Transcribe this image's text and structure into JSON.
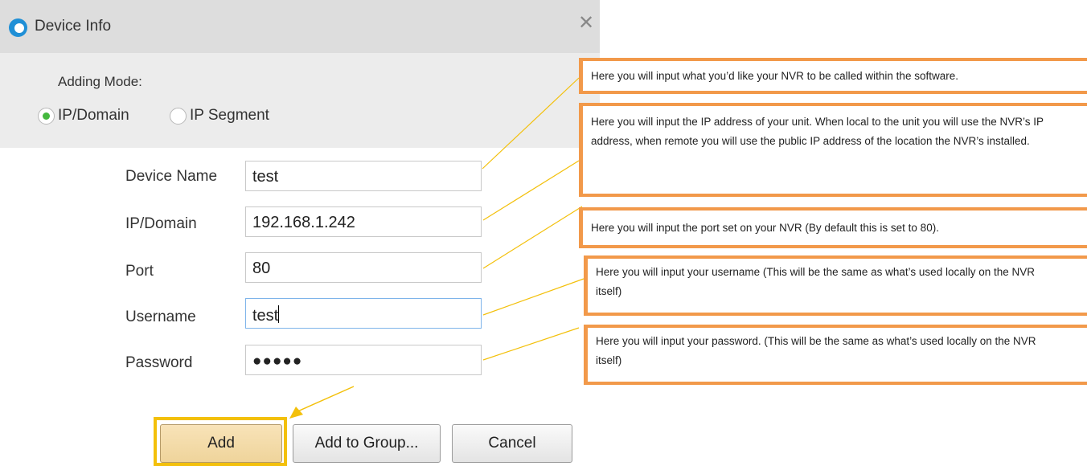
{
  "dialog": {
    "title": "Device Info",
    "adding_mode_label": "Adding Mode:",
    "modes": [
      {
        "label": "IP/Domain",
        "checked": true
      },
      {
        "label": "IP Segment",
        "checked": false
      }
    ],
    "fields": [
      {
        "label": "Device Name",
        "value": "test"
      },
      {
        "label": "IP/Domain",
        "value": "192.168.1.242"
      },
      {
        "label": "Port",
        "value": "80"
      },
      {
        "label": "Username",
        "value": "test"
      },
      {
        "label": "Password",
        "value": "●●●●●"
      }
    ],
    "buttons": {
      "add": "Add",
      "add_to_group": "Add to Group...",
      "cancel": "Cancel"
    }
  },
  "callouts": [
    "Here you will input what you’d like your NVR to be called within the software.",
    "Here you will input the IP address of your unit.  When local to the unit you will use the NVR’s IP address, when remote you will use the public IP address of the location the NVR’s installed.",
    "Here you will input the port set on your NVR (By default this is set to 80).",
    "Here you will input your username (This will be the same as what’s used locally on the NVR itself)",
    "Here you will input your password. (This will be the same as what’s used locally on the NVR itself)"
  ],
  "colors": {
    "callout_border": "#f2994a",
    "leader_line": "#f3c00b",
    "radio_checked": "#44b83e",
    "add_highlight": "#f3c00b"
  }
}
